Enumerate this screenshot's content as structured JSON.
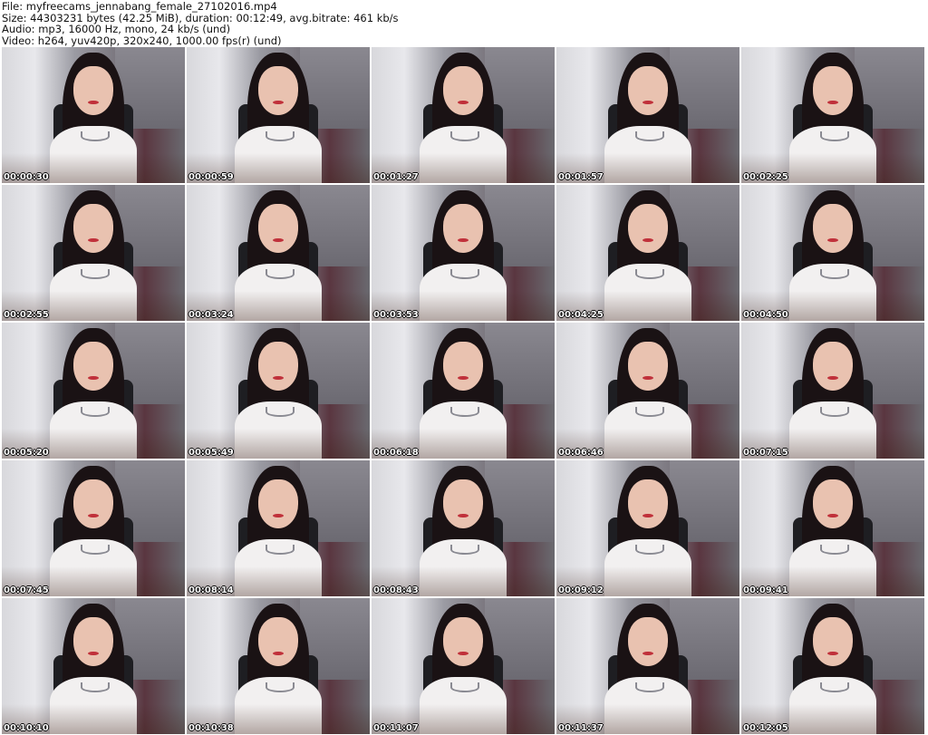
{
  "info": {
    "file": "File: myfreecams_jennabang_female_27102016.mp4",
    "size": "Size: 44303231 bytes (42.25 MiB), duration: 00:12:49, avg.bitrate: 461 kb/s",
    "audio": "Audio: mp3, 16000 Hz, mono, 24 kb/s (und)",
    "video": "Video: h264, yuv420p, 320x240, 1000.00 fps(r) (und)"
  },
  "thumbnails": [
    "00:00:30",
    "00:00:59",
    "00:01:27",
    "00:01:57",
    "00:02:25",
    "00:02:55",
    "00:03:24",
    "00:03:53",
    "00:04:25",
    "00:04:50",
    "00:05:20",
    "00:05:49",
    "00:06:18",
    "00:06:46",
    "00:07:15",
    "00:07:45",
    "00:08:14",
    "00:08:43",
    "00:09:12",
    "00:09:41",
    "00:10:10",
    "00:10:38",
    "00:11:07",
    "00:11:37",
    "00:12:05"
  ]
}
